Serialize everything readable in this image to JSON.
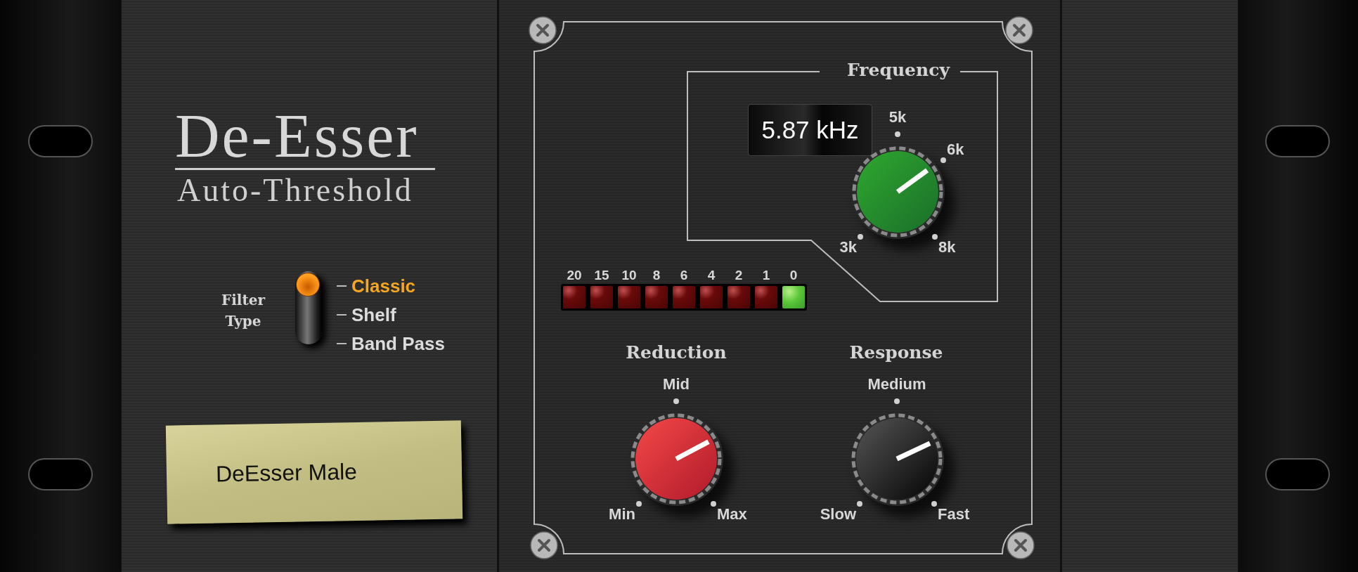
{
  "plugin": {
    "title": "De-Esser",
    "subtitle": "Auto-Threshold"
  },
  "filter_type": {
    "label": "Filter Type",
    "options": [
      {
        "label": "Classic",
        "selected": true
      },
      {
        "label": "Shelf",
        "selected": false
      },
      {
        "label": "Band Pass",
        "selected": false
      }
    ]
  },
  "preset": {
    "name": "DeEsser Male"
  },
  "frequency": {
    "title": "Frequency",
    "readout": "5.87 kHz",
    "level": 0.7,
    "scale": [
      {
        "text": "5k",
        "kind": "top"
      },
      {
        "text": "6k",
        "kind": "upper-right"
      },
      {
        "text": "3k",
        "kind": "lower-left"
      },
      {
        "text": "8k",
        "kind": "lower-right"
      }
    ]
  },
  "meter": {
    "segments": [
      {
        "label": "20",
        "on": false
      },
      {
        "label": "15",
        "on": false
      },
      {
        "label": "10",
        "on": false
      },
      {
        "label": "8",
        "on": false
      },
      {
        "label": "6",
        "on": false
      },
      {
        "label": "4",
        "on": false
      },
      {
        "label": "2",
        "on": false
      },
      {
        "label": "1",
        "on": false
      },
      {
        "label": "0",
        "on": true
      }
    ]
  },
  "reduction": {
    "title": "Reduction",
    "level": 0.73,
    "scale": [
      {
        "text": "Mid",
        "kind": "top"
      },
      {
        "text": "Min",
        "kind": "lower-left"
      },
      {
        "text": "Max",
        "kind": "lower-right"
      }
    ]
  },
  "response": {
    "title": "Response",
    "level": 0.74,
    "scale": [
      {
        "text": "Medium",
        "kind": "top"
      },
      {
        "text": "Slow",
        "kind": "lower-left"
      },
      {
        "text": "Fast",
        "kind": "lower-right"
      }
    ]
  }
}
